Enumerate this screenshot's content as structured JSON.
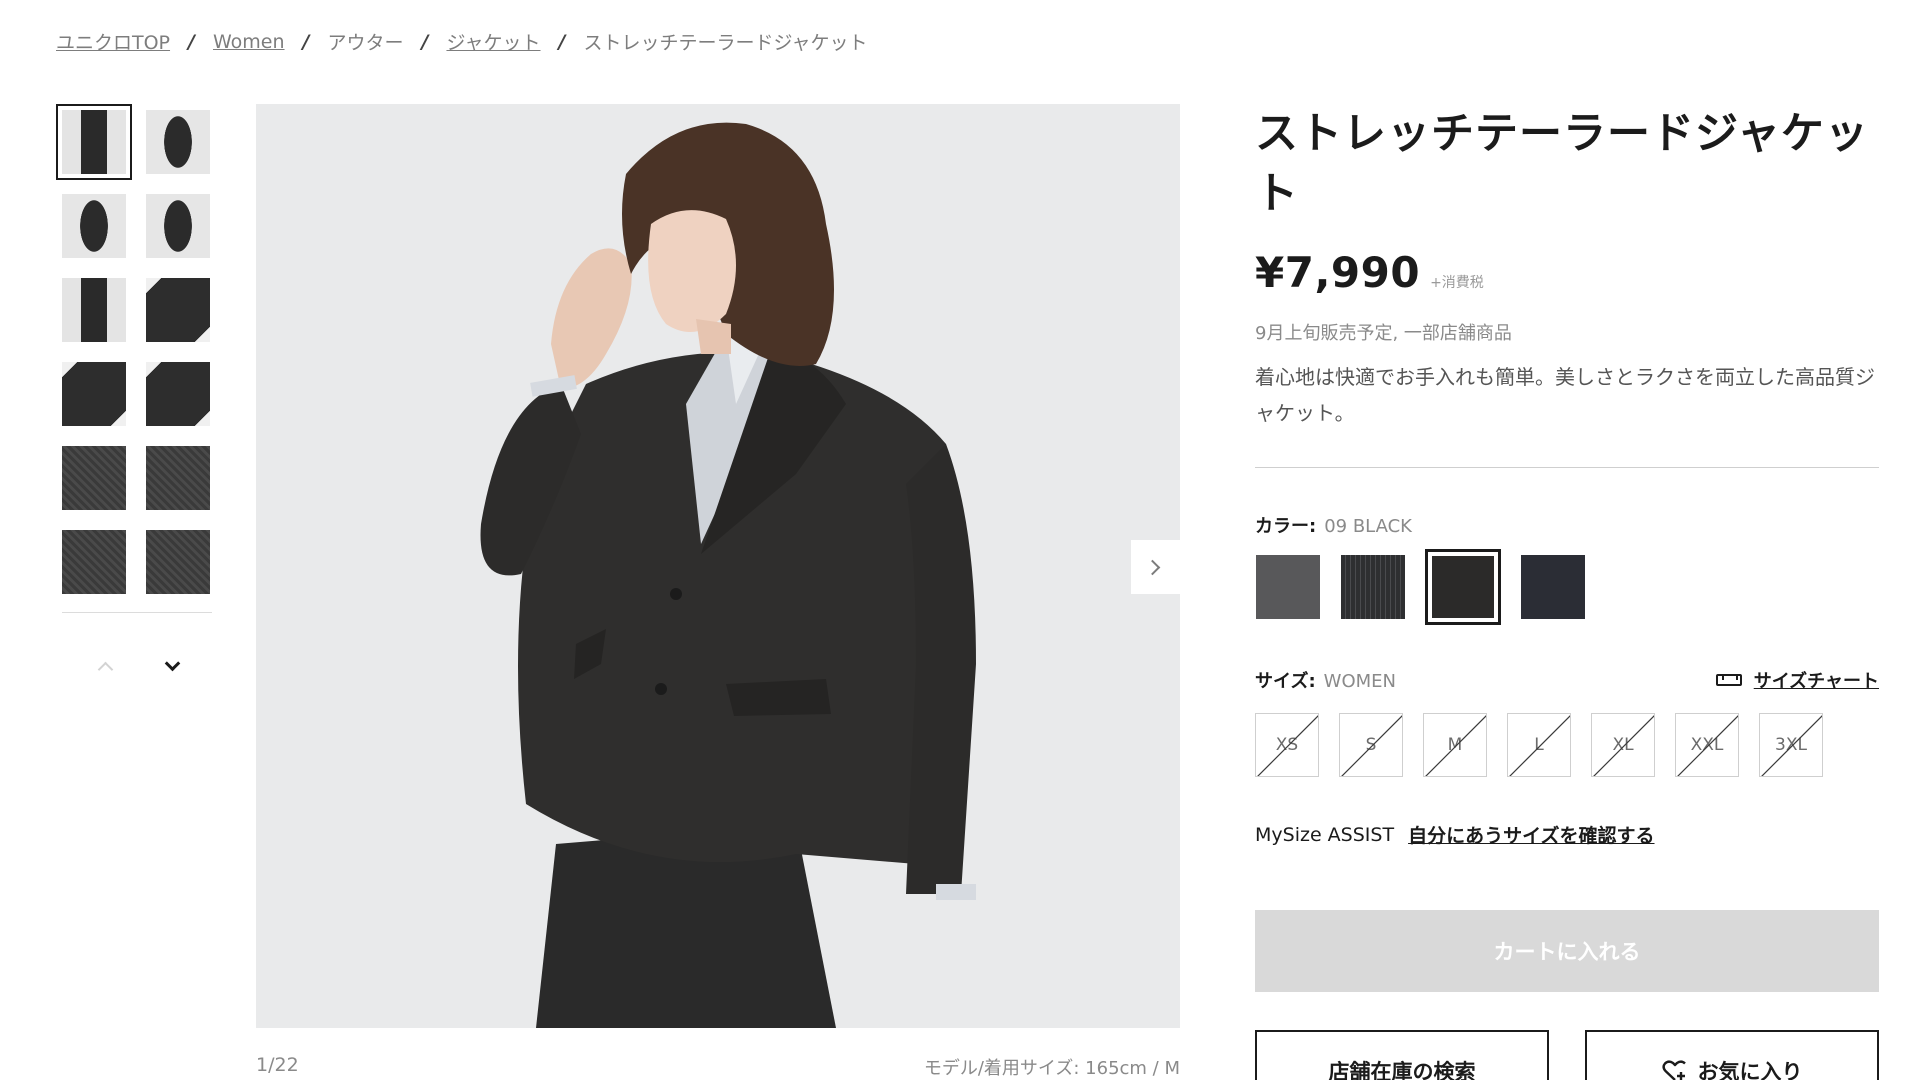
{
  "breadcrumb": [
    {
      "label": "ユニクロTOP",
      "link": true
    },
    {
      "label": "Women",
      "link": true
    },
    {
      "label": "アウター",
      "link": false
    },
    {
      "label": "ジャケット",
      "link": true
    },
    {
      "label": "ストレッチテーラードジャケット",
      "link": false
    }
  ],
  "breadcrumb_separator": "/",
  "gallery": {
    "thumbnails": [
      "model",
      "model2",
      "model2",
      "model2",
      "model",
      "flat",
      "flat",
      "flat",
      "fabric",
      "fabric",
      "fabric",
      "fabric"
    ],
    "active_index": 0,
    "counter": "1/22",
    "model_size": "モデル/着用サイズ: 165cm / M"
  },
  "product": {
    "title": "ストレッチテーラードジャケット",
    "price": "¥7,990",
    "tax_note": "+消費税",
    "availability": "9月上旬販売予定, 一部店舗商品",
    "description": "着心地は快適でお手入れも簡単。美しさとラクさを両立した高品質ジャケット。"
  },
  "color": {
    "label": "カラー:",
    "selected": "09 BLACK",
    "swatches": [
      {
        "color": "#58585a",
        "pattern": "plain"
      },
      {
        "color": "#2e2f31",
        "pattern": "stripe"
      },
      {
        "color": "#2b2a29",
        "pattern": "plain",
        "selected": true
      },
      {
        "color": "#2b2d35",
        "pattern": "plain"
      }
    ]
  },
  "size": {
    "label": "サイズ:",
    "category": "WOMEN",
    "chart_link": "サイズチャート",
    "options": [
      "XS",
      "S",
      "M",
      "L",
      "XL",
      "XXL",
      "3XL"
    ],
    "all_unavailable": true
  },
  "mysize": {
    "label": "MySize ASSIST",
    "link": "自分にあうサイズを確認する"
  },
  "actions": {
    "add_to_cart": "カートに入れる",
    "store_search": "店舗在庫の検索",
    "favorite": "お気に入り"
  }
}
